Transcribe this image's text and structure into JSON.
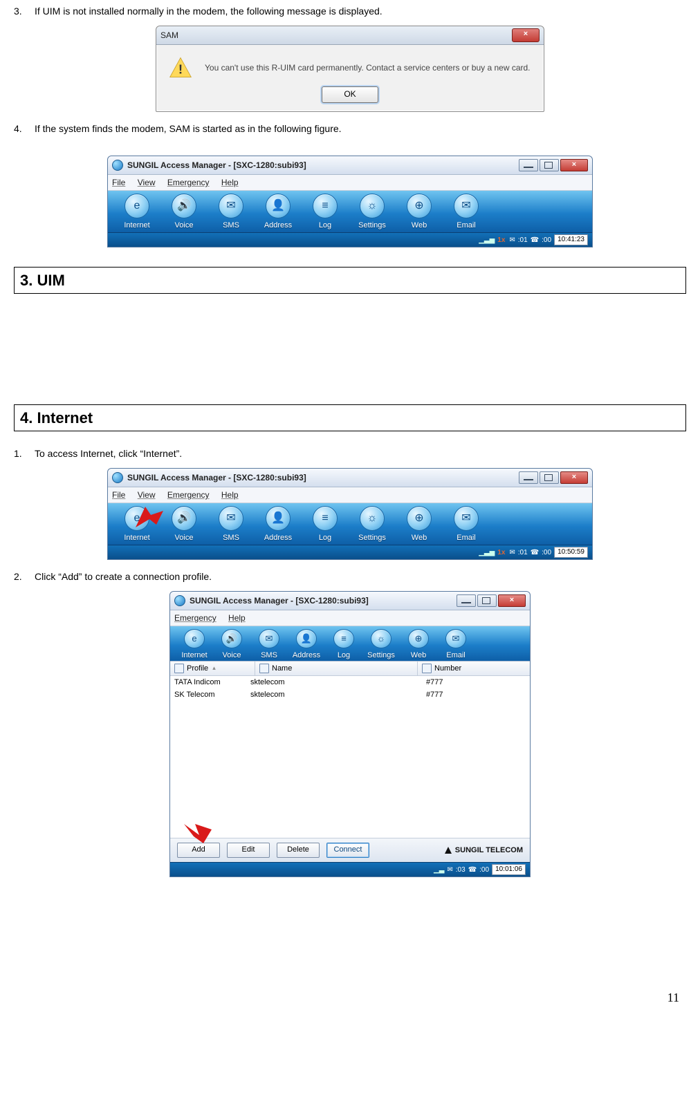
{
  "doc": {
    "li3_num": "3.",
    "li3_text": "If UIM is not installed normally in the modem, the following message is displayed.",
    "li4_num": "4.",
    "li4_text": "If the system finds the modem, SAM is started as in the following figure.",
    "sec3": "3. UIM",
    "sec4": "4. Internet",
    "int_li1_num": "1.",
    "int_li1_text": "To access Internet, click “Internet”.",
    "int_li2_num": "2.",
    "int_li2_text": "Click “Add” to create a connection profile.",
    "page_number": "11"
  },
  "sam_dialog": {
    "title": "SAM",
    "message": "You can't use this R-UIM card permanently. Contact a service centers or buy a new card.",
    "ok_label": "OK",
    "close_x": "×"
  },
  "app": {
    "title": "SUNGIL Access Manager - [SXC-1280:subi93]",
    "close_x": "×",
    "menu": {
      "file": "File",
      "view": "View",
      "emergency": "Emergency",
      "help": "Help"
    },
    "menu2": {
      "emergency": "Emergency",
      "help": "Help"
    },
    "toolbar": {
      "internet": "Internet",
      "voice": "Voice",
      "sms": "SMS",
      "address": "Address",
      "log": "Log",
      "settings": "Settings",
      "web": "Web",
      "email": "Email"
    },
    "status1": {
      "onex": "1x",
      "msg_count": ":01",
      "voice_count": ":00",
      "clock": "10:41:23"
    },
    "status2": {
      "onex": "1x",
      "msg_count": ":01",
      "voice_count": ":00",
      "clock": "10:50:59"
    },
    "status3": {
      "msg_count": ":03",
      "voice_count": ":00",
      "clock": "10:01:06"
    }
  },
  "profiles": {
    "col_profile": "Profile",
    "col_name": "Name",
    "col_number": "Number",
    "rows": [
      {
        "profile": "TATA Indicom",
        "name": "sktelecom",
        "number": "#777"
      },
      {
        "profile": "SK Telecom",
        "name": "sktelecom",
        "number": "#777"
      }
    ],
    "btn_add": "Add",
    "btn_edit": "Edit",
    "btn_delete": "Delete",
    "btn_connect": "Connect",
    "brand": "SUNGIL TELECOM"
  },
  "icons": {
    "internet": "e",
    "voice": "🔊",
    "sms": "✉",
    "address": "👤",
    "log": "≡",
    "settings": "☼",
    "web": "⊕",
    "email": "✉"
  }
}
